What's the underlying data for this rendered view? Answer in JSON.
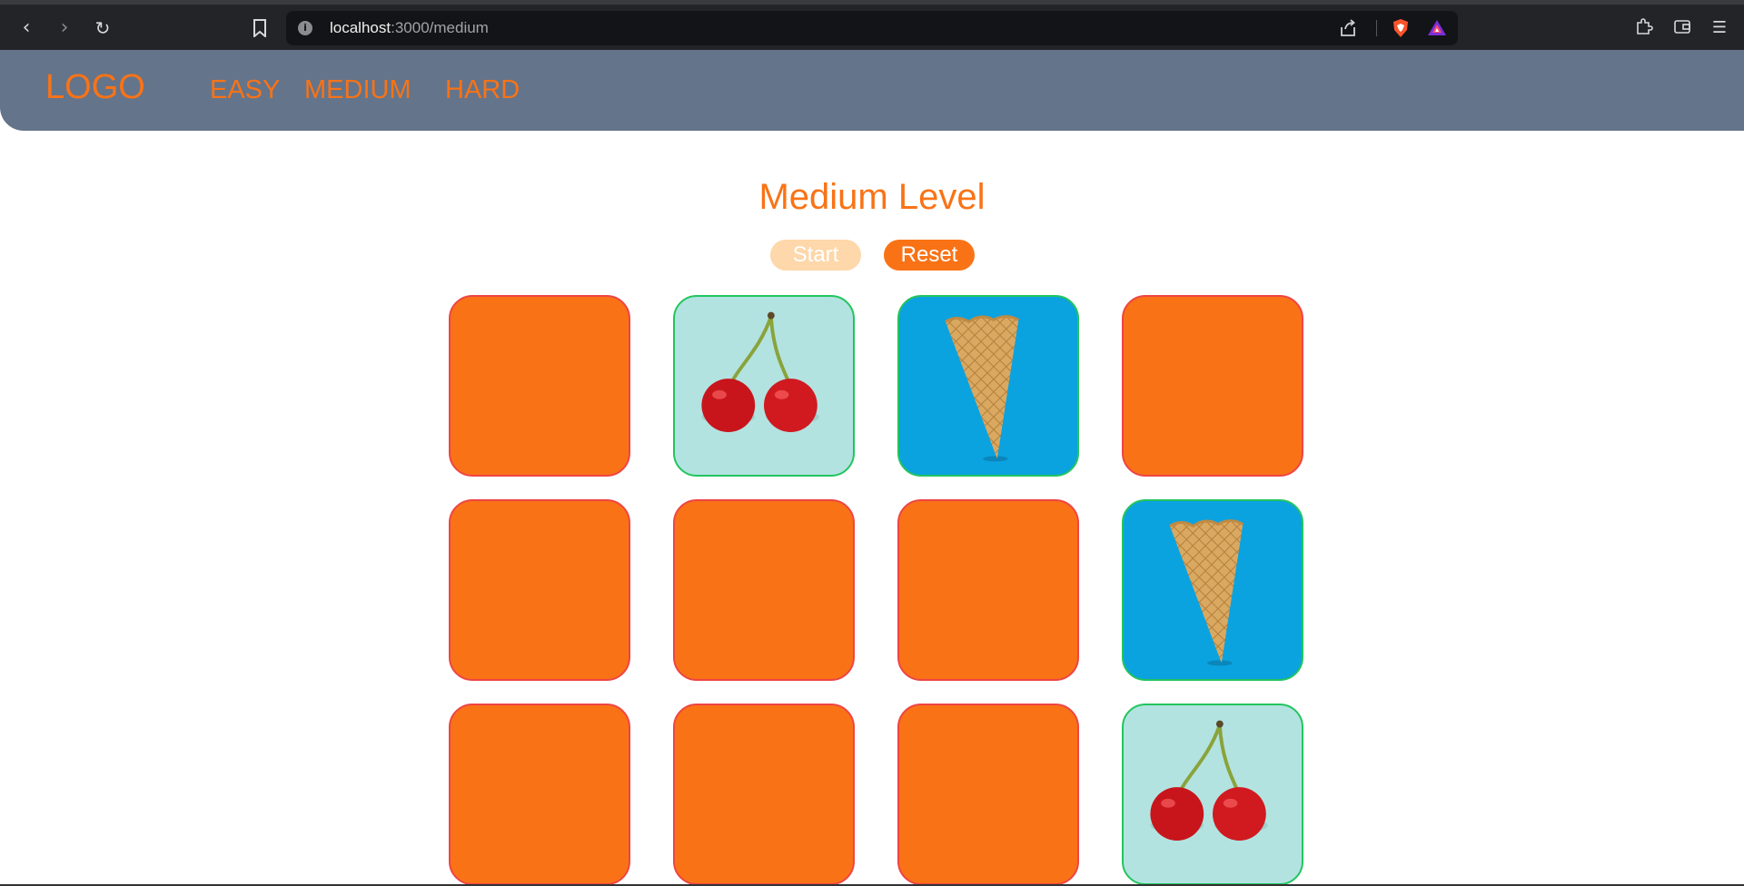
{
  "browser": {
    "url_host": "localhost",
    "url_path": ":3000/medium"
  },
  "header": {
    "logo": "LOGO",
    "nav": [
      "EASY",
      "MEDIUM",
      "HARD"
    ]
  },
  "game": {
    "title": "Medium Level",
    "start_label": "Start",
    "reset_label": "Reset",
    "cards": [
      {
        "state": "face-down"
      },
      {
        "state": "face-up",
        "image": "cherries"
      },
      {
        "state": "face-up",
        "image": "ice-cream-cone"
      },
      {
        "state": "face-down"
      },
      {
        "state": "face-down"
      },
      {
        "state": "face-down"
      },
      {
        "state": "face-down"
      },
      {
        "state": "face-up",
        "image": "ice-cream-cone"
      },
      {
        "state": "face-down"
      },
      {
        "state": "face-down"
      },
      {
        "state": "face-down"
      },
      {
        "state": "face-up",
        "image": "cherries"
      }
    ]
  },
  "colors": {
    "accent": "#f97316",
    "header_bg": "#64748b",
    "card_border_down": "#ef4444",
    "card_border_up": "#22c55e",
    "start_disabled": "#fed7aa"
  }
}
